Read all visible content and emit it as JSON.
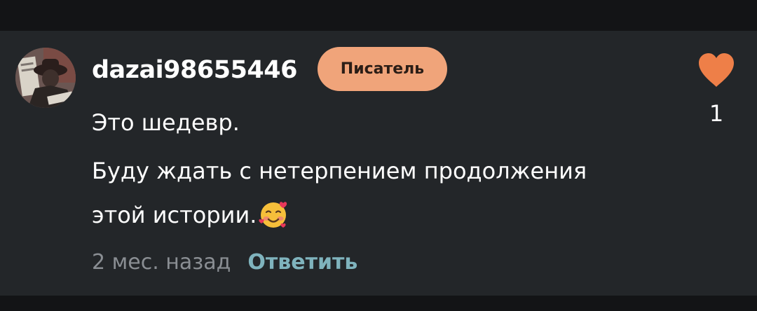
{
  "comment": {
    "author": "dazai98655446",
    "badge": "Писатель",
    "lines": [
      "Это шедевр.",
      "Буду ждать с нетерпением продолжения",
      "этой истории."
    ],
    "emoji": "smiling-face-with-hearts",
    "timestamp": "2 мес. назад",
    "reply_label": "Ответить",
    "likes": "1",
    "liked": true
  },
  "colors": {
    "background": "#131416",
    "card": "#232629",
    "badge": "#f0a47a",
    "heart": "#ee7f48",
    "reply": "#7fb3bd",
    "timestamp": "#8a8e93"
  }
}
